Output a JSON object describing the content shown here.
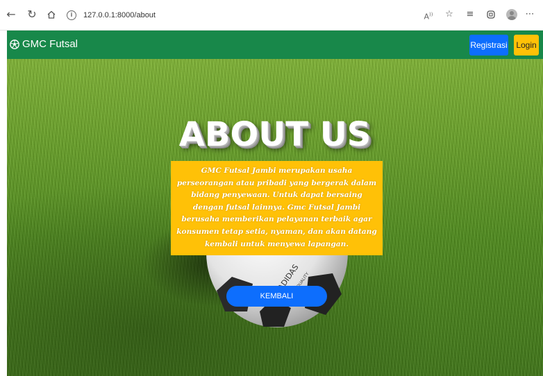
{
  "browser": {
    "back_icon": "back-arrow-icon",
    "refresh_icon": "refresh-icon",
    "home_icon": "home-icon",
    "url": "127.0.0.1:8000/about",
    "read_aloud": "A⁾",
    "icons": [
      "read-aloud-icon",
      "add-favorite-icon",
      "favorites-icon",
      "collections-icon",
      "profile-avatar",
      "more-icon"
    ]
  },
  "navbar": {
    "brand": "GMC Futsal",
    "register_label": "Registrasi",
    "login_label": "Login",
    "bg_color": "#18884a"
  },
  "hero": {
    "title": "ABOUT US",
    "description": "GMC Futsal Jambi merupakan usaha perseorangan atau pribadi yang bergerak dalam bidang penyewaan. Untuk dapat bersaing dengan futsal lainnya. Gmc Futsal Jambi berusaha memberikan pelayanan terbaik agar konsumen tetap setia, nyaman, dan akan datang kembali untuk menyewa lapangan.",
    "back_button_label": "KEMBALI",
    "box_color": "#ffc107",
    "button_color": "#0d6efd"
  }
}
